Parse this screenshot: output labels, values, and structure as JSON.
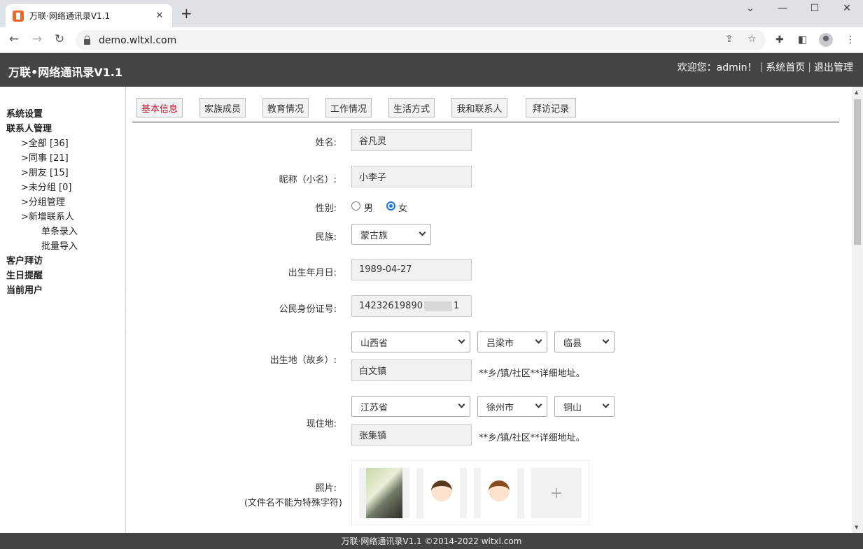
{
  "browser": {
    "tab_title": "万联·网络通讯录V1.1",
    "url": "demo.wltxl.com"
  },
  "header": {
    "title": "万联•网络通讯录V1.1",
    "welcome": "欢迎您：admin！",
    "home_link": "系统首页",
    "logout_link": "退出管理"
  },
  "sidebar": {
    "system_settings": "系统设置",
    "contact_mgmt": "联系人管理",
    "all": ">全部 [36]",
    "colleagues": ">同事 [21]",
    "friends": ">朋友 [15]",
    "ungrouped": ">未分组 [0]",
    "group_mgmt": ">分组管理",
    "add_contact": ">新增联系人",
    "single_entry": "单条录入",
    "batch_import": "批量导入",
    "customer_visits": "客户拜访",
    "birthday_reminder": "生日提醒",
    "current_user": "当前用户"
  },
  "tabs": [
    "基本信息",
    "家族成员",
    "教育情况",
    "工作情况",
    "生活方式",
    "我和联系人",
    "拜访记录"
  ],
  "form": {
    "name_label": "姓名:",
    "name_value": "谷凡灵",
    "nickname_label": "昵称（小名）:",
    "nickname_value": "小李子",
    "gender_label": "性别:",
    "gender_male": "男",
    "gender_female": "女",
    "ethnicity_label": "民族:",
    "ethnicity_value": "蒙古族",
    "birthdate_label": "出生年月日:",
    "birthdate_value": "1989-04-27",
    "id_label": "公民身份证号:",
    "id_value": "14232619890",
    "id_tail": "1",
    "birthplace_label": "出生地（故乡）:",
    "birth_province": "山西省",
    "birth_city": "吕梁市",
    "birth_county": "临县",
    "birth_town": "白文镇",
    "address_hint": "**乡/镇/社区**详细地址。",
    "current_label": "现住地:",
    "cur_province": "江苏省",
    "cur_city": "徐州市",
    "cur_county": "铜山",
    "cur_town": "张集镇",
    "address_hint2": "**乡/镇/社区**详细地址。",
    "photo_label": "照片:",
    "photo_note": "(文件名不能为特殊字符)",
    "add_photo": "+"
  },
  "footer": "万联·网络通讯录V1.1 ©2014-2022 wltxl.com"
}
